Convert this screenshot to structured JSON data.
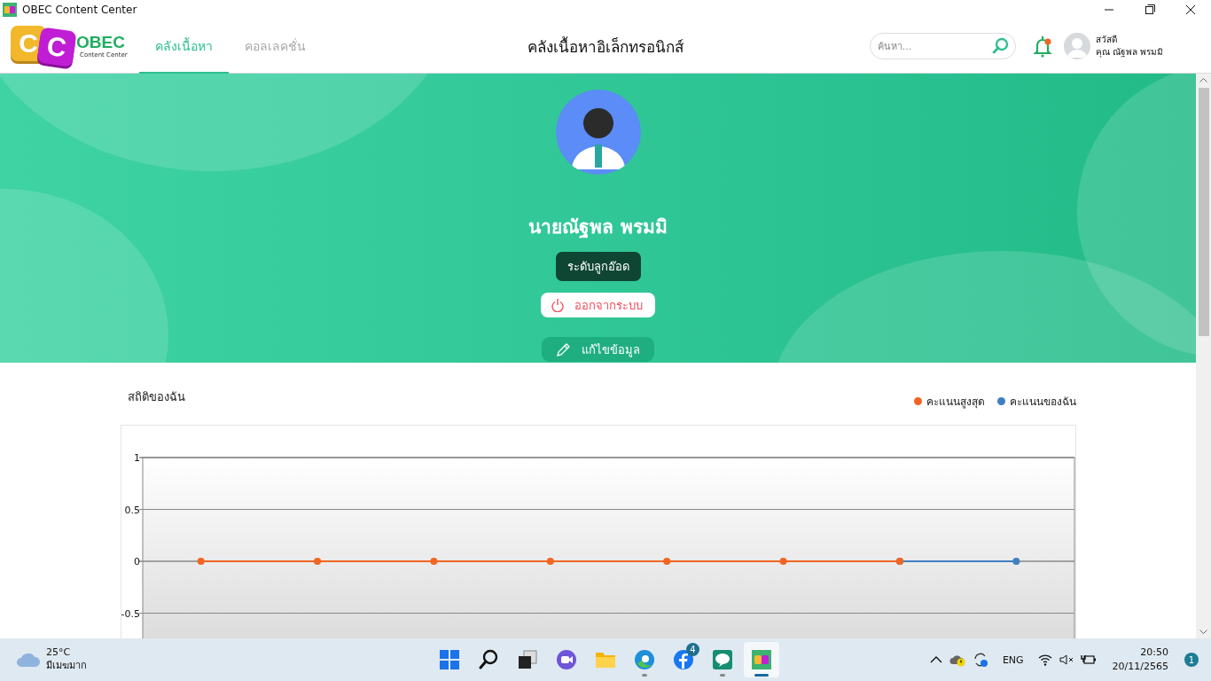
{
  "window": {
    "title": "OBEC Content Center"
  },
  "header": {
    "logo": {
      "letters": [
        "C",
        "C"
      ],
      "name": "OBEC",
      "subtitle": "Content Center"
    },
    "tabs": [
      {
        "label": "คลังเนื้อหา",
        "selected": true
      },
      {
        "label": "คอลเลคชั่น",
        "selected": false
      }
    ],
    "title": "คลังเนื้อหาอิเล็กทรอนิกส์",
    "search": {
      "placeholder": "ค้นหา..."
    },
    "notifications": {
      "unread": true
    },
    "user": {
      "greeting": "สวัสดี",
      "name": "คุณ ณัฐพล พรมมิ"
    }
  },
  "profile": {
    "name": "นายณัฐพล พรมมิ",
    "level": "ระดับลูกอ๊อด",
    "logout": "ออกจากระบบ",
    "edit": "แก้ไขข้อมูล"
  },
  "stats": {
    "title": "สถิติของฉัน",
    "chart_data": {
      "type": "line",
      "grid": true,
      "ylim": [
        -0.76,
        1
      ],
      "yticks": [
        -0.5,
        0,
        0.5,
        1
      ],
      "series": [
        {
          "name": "คะแนนสูงสุด",
          "color": "#f26522",
          "marker": "circle",
          "values": [
            0,
            0,
            0,
            0,
            0,
            0,
            0,
            null
          ]
        },
        {
          "name": "คะแนนของฉัน",
          "color": "#3f7fbf",
          "marker": "circle",
          "values": [
            null,
            null,
            null,
            null,
            null,
            null,
            0,
            0
          ]
        }
      ]
    }
  },
  "taskbar": {
    "weather": {
      "temperature": "25°C",
      "condition": "มีเมฆมาก"
    },
    "apps": [
      {
        "kind": "start",
        "running": false,
        "selected": false
      },
      {
        "kind": "search",
        "running": false,
        "selected": false
      },
      {
        "kind": "taskview",
        "running": false,
        "selected": false
      },
      {
        "kind": "meet",
        "running": false,
        "selected": false
      },
      {
        "kind": "folder",
        "running": false,
        "selected": false
      },
      {
        "kind": "edge",
        "running": true,
        "selected": false
      },
      {
        "kind": "facebook",
        "running": false,
        "selected": false,
        "badge": "4"
      },
      {
        "kind": "line",
        "running": true,
        "selected": false
      },
      {
        "kind": "obec",
        "running": true,
        "selected": true
      }
    ],
    "language": "ENG",
    "time": "20:50",
    "date": "20/11/2565",
    "notification_count": "1"
  }
}
